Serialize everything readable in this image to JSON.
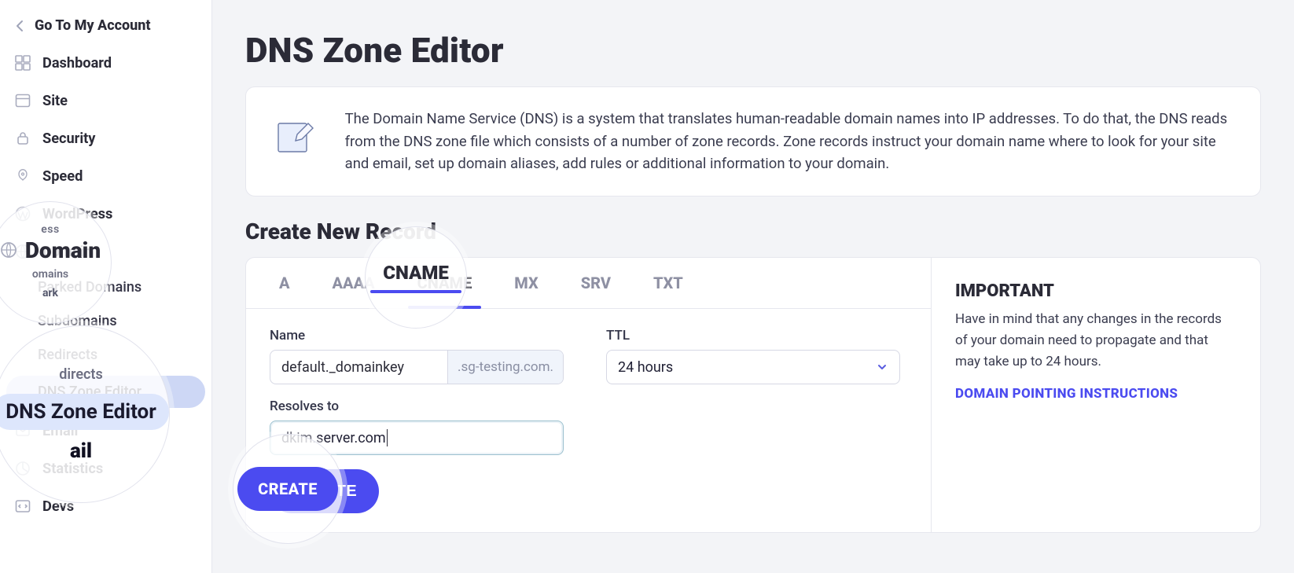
{
  "sidebar": {
    "goto_label": "Go To My Account",
    "items": {
      "dashboard": "Dashboard",
      "site": "Site",
      "security": "Security",
      "speed": "Speed",
      "wordpress": "WordPress",
      "domain": "Domain",
      "email": "Email",
      "statistics": "Statistics",
      "devs": "Devs"
    },
    "domain_sub": {
      "parked": "Parked Domains",
      "subdomains": "Subdomains",
      "redirects": "Redirects",
      "dns": "DNS Zone Editor"
    }
  },
  "page": {
    "title": "DNS Zone Editor"
  },
  "info": {
    "text": "The Domain Name Service (DNS) is a system that translates human-readable domain names into IP addresses. To do that, the DNS reads from the DNS zone file which consists of a number of zone records. Zone records instruct your domain name where to look for your site and email, set up domain aliases, add rules or additional information to your domain."
  },
  "form": {
    "section_title": "Create New Record",
    "tabs": {
      "a": "A",
      "aaaa": "AAAA",
      "cname": "CNAME",
      "mx": "MX",
      "srv": "SRV",
      "txt": "TXT"
    },
    "labels": {
      "name": "Name",
      "ttl": "TTL",
      "resolves": "Resolves to"
    },
    "values": {
      "name": "default._domainkey",
      "suffix": ".sg-testing.com.",
      "ttl": "24 hours",
      "resolves": "dkim.server.com"
    },
    "create_button": "CREATE"
  },
  "aside": {
    "title": "IMPORTANT",
    "text": "Have in mind that any changes in the records of your domain need to propagate and that may take up to 24 hours.",
    "link": "DOMAIN POINTING INSTRUCTIONS"
  },
  "mag": {
    "domain_label": "Domain",
    "domain_sub": "omains",
    "dns_redirects": "directs",
    "dns_label": "DNS Zone Editor",
    "dns_mail": "ail",
    "cname": "CNAME",
    "create": "CREATE",
    "parked_partial": "ark"
  }
}
